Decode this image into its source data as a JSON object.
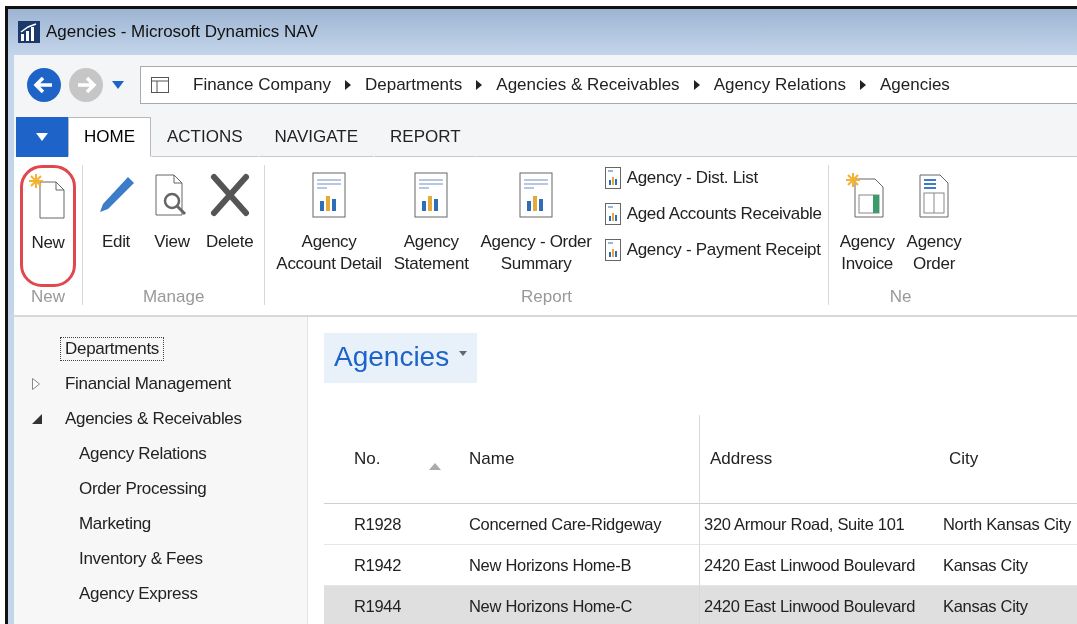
{
  "window": {
    "title": "Agencies - Microsoft Dynamics NAV"
  },
  "breadcrumb": [
    "Finance Company",
    "Departments",
    "Agencies & Receivables",
    "Agency Relations",
    "Agencies"
  ],
  "tabs": [
    {
      "label": "HOME",
      "selected": true
    },
    {
      "label": "ACTIONS",
      "selected": false
    },
    {
      "label": "NAVIGATE",
      "selected": false
    },
    {
      "label": "REPORT",
      "selected": false
    }
  ],
  "ribbon_groups": [
    {
      "label": "New",
      "actions": [
        {
          "kind": "new",
          "lines": [
            "New"
          ],
          "highlighted": true
        }
      ]
    },
    {
      "label": "Manage",
      "actions": [
        {
          "kind": "edit",
          "lines": [
            "Edit"
          ]
        },
        {
          "kind": "view",
          "lines": [
            "View"
          ]
        },
        {
          "kind": "delete",
          "lines": [
            "Delete"
          ]
        }
      ]
    },
    {
      "label": "Report",
      "actions": [
        {
          "kind": "report",
          "lines": [
            "Agency",
            "Account Detail"
          ]
        },
        {
          "kind": "report",
          "lines": [
            "Agency",
            "Statement"
          ]
        },
        {
          "kind": "report",
          "lines": [
            "Agency - Order",
            "Summary"
          ]
        }
      ],
      "small_actions": [
        "Agency - Dist. List",
        "Aged Accounts Receivable",
        "Agency - Payment Receipt"
      ]
    },
    {
      "label": "Ne",
      "actions": [
        {
          "kind": "invoice",
          "lines": [
            "Agency",
            "Invoice"
          ]
        },
        {
          "kind": "order",
          "lines": [
            "Agency",
            "Order"
          ]
        }
      ]
    }
  ],
  "navigation": [
    {
      "label": "Departments",
      "selected": true
    },
    {
      "label": "Financial Management",
      "expanded": false,
      "selected": false
    },
    {
      "label": "Agencies & Receivables",
      "expanded": true,
      "selected": false,
      "children": [
        {
          "label": "Agency Relations",
          "selected": false
        },
        {
          "label": "Order Processing",
          "selected": false
        },
        {
          "label": "Marketing",
          "selected": false
        },
        {
          "label": "Inventory & Fees",
          "selected": false
        },
        {
          "label": "Agency Express",
          "selected": false
        }
      ]
    }
  ],
  "page_title": "Agencies",
  "table": {
    "columns": [
      {
        "label": "No.",
        "sorted": true
      },
      {
        "label": "Name",
        "sorted": false
      },
      {
        "label": "Address",
        "sorted": false
      },
      {
        "label": "City",
        "sorted": false
      }
    ],
    "rows": [
      {
        "cells": [
          "R1928",
          "Concerned Care-Ridgeway",
          "320 Armour Road, Suite 101",
          "North Kansas City"
        ],
        "selected": false
      },
      {
        "cells": [
          "R1942",
          "New Horizons Home-B",
          "2420 East Linwood Boulevard",
          "Kansas City"
        ],
        "selected": false
      },
      {
        "cells": [
          "R1944",
          "New Horizons Home-C",
          "2420 East Linwood Boulevard",
          "Kansas City"
        ],
        "selected": true
      }
    ]
  }
}
